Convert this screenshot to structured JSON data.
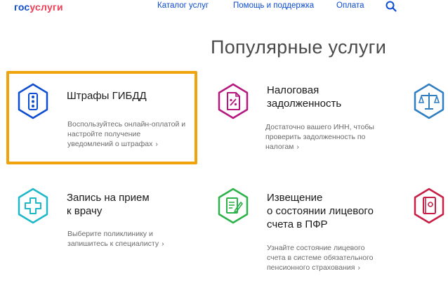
{
  "header": {
    "logo_gos": "гос",
    "logo_uslugi": "услуги",
    "nav": {
      "catalog": "Каталог услуг",
      "help": "Помощь и поддержка",
      "payment": "Оплата"
    }
  },
  "main": {
    "title": "Популярные услуги",
    "cards": {
      "fines": {
        "title": "Штрафы ГИБДД",
        "desc_1": "Воспользуйтесь онлайн-оплатой и",
        "desc_2": "настройте получение",
        "desc_3": "уведомлений о штрафах"
      },
      "tax": {
        "title_1": "Налоговая",
        "title_2": "задолженность",
        "desc_1": "Достаточно вашего ИНН, чтобы",
        "desc_2": "проверить задолженность по",
        "desc_3": "налогам"
      },
      "doctor": {
        "title_1": "Запись на прием",
        "title_2": "к врачу",
        "desc_1": "Выберите поликлинику и",
        "desc_2": "запишитесь к специалисту"
      },
      "pfr": {
        "title_1": "Извещение",
        "title_2": "о состоянии лицевого",
        "title_3": "счета в ПФР",
        "desc_1": "Узнайте состояние лицевого",
        "desc_2": "счета в системе обязательного",
        "desc_3": "пенсионного страхования"
      }
    }
  },
  "colors": {
    "brand_blue": "#0d4cd3",
    "brand_red": "#ee3f58",
    "highlight": "#f0a30a",
    "icon_fines": "#0d4cd3",
    "icon_tax": "#b5177e",
    "icon_doctor": "#1fb8c8",
    "icon_pfr": "#2bb34a",
    "icon_court": "#2f7ec2",
    "icon_partial": "#c81e45"
  }
}
